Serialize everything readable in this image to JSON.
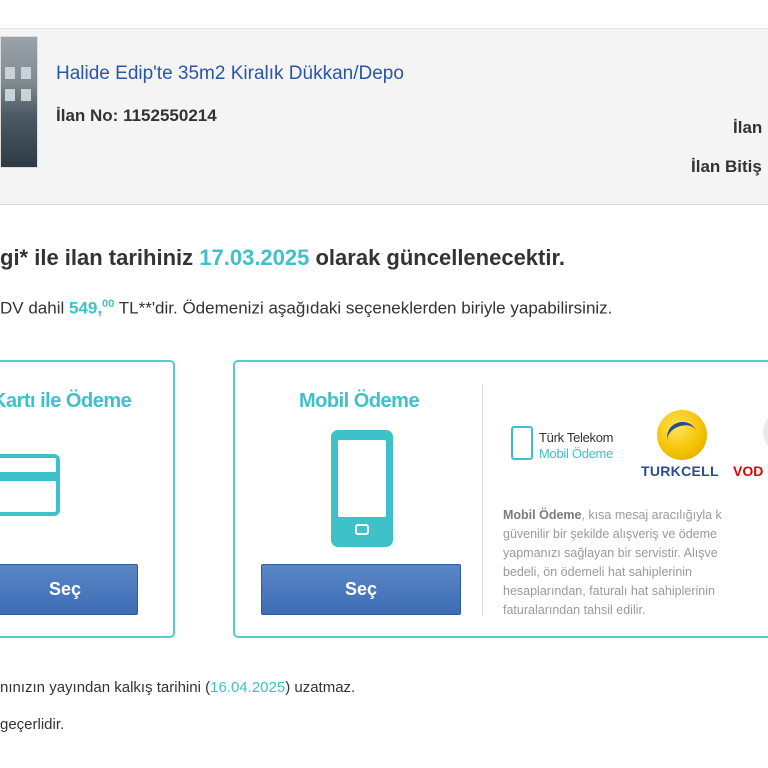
{
  "listing": {
    "title": "Halide Edip'te 35m2 Kiralık Dükkan/Depo",
    "number_label": "İlan No:",
    "number_value": "1152550214",
    "right_label_1": "İlan",
    "right_label_2": "İlan Bitiş"
  },
  "headline": {
    "prefix": "gi* ile ilan tarihiniz ",
    "date": "17.03.2025",
    "suffix": " olarak güncellenecektir."
  },
  "price_line": {
    "prefix": "DV dahil ",
    "price_main": "549,",
    "price_decimals": "00",
    "suffix": " TL**'dir. Ödemenizi aşağıdaki seçeneklerden biriyle yapabilirsiniz."
  },
  "card_payment": {
    "title": "Kartı ile Ödeme",
    "button_label": "Seç",
    "icon": "credit-card-icon"
  },
  "mobile_payment": {
    "title": "Mobil Ödeme",
    "button_label": "Seç",
    "icon": "mobile-phone-icon",
    "operators": {
      "turk_telekom_line1": "Türk Telekom",
      "turk_telekom_line2": "Mobil Ödeme",
      "turkcell": "TURKCELL",
      "vodafone": "VOD"
    },
    "description": {
      "bold": "Mobil Ödeme",
      "line1": ", kısa mesaj aracılığıyla k",
      "line2": "güvenilir bir şekilde alışveriş ve ödeme",
      "line3": "yapmanızı sağlayan bir servistir. Alışve",
      "line4": "bedeli, ön ödemeli hat sahiplerinin",
      "line5": "hesaplarından, faturalı hat sahiplerinin",
      "line6": "faturalarından tahsil edilir."
    }
  },
  "footnotes": {
    "note1_prefix": "nınızın yayından kalkış tarihini (",
    "note1_date": "16.04.2025",
    "note1_suffix": ") uzatmaz.",
    "note2": "geçerlidir."
  },
  "colors": {
    "accent": "#3fc1c9",
    "link": "#2a56a6",
    "button": "#3c6cb4"
  }
}
